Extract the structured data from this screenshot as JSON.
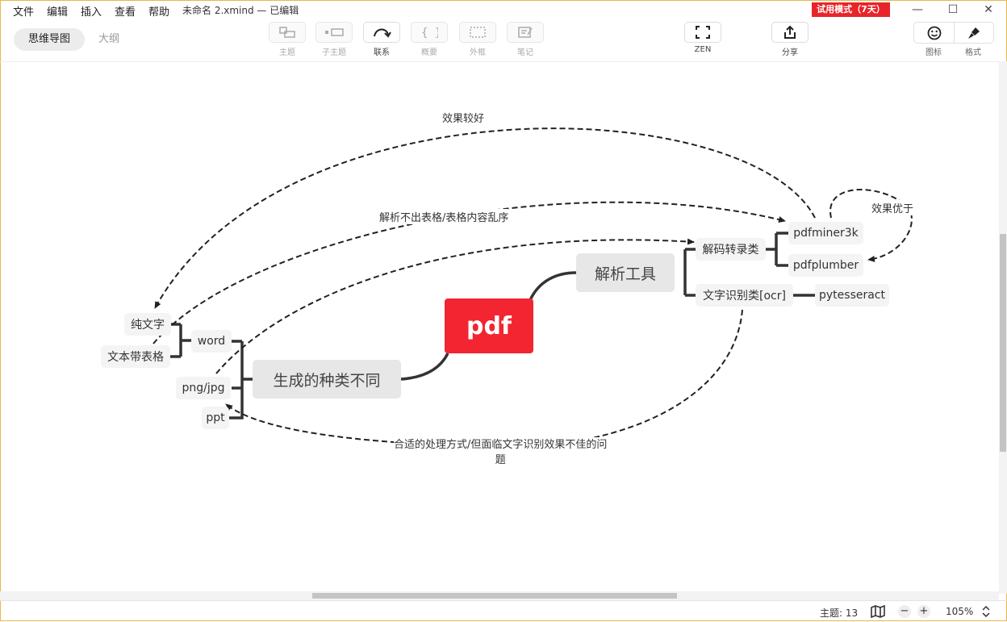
{
  "menu": [
    "文件",
    "编辑",
    "插入",
    "查看",
    "帮助"
  ],
  "window_title": "未命名 2.xmind — 已编辑",
  "trial_badge": "试用模式（7天）",
  "window_controls": {
    "minimize": "—",
    "maximize": "☐",
    "close": "✕"
  },
  "view_tabs": {
    "mindmap": "思维导图",
    "outline": "大纲"
  },
  "toolbar": {
    "topic": "主题",
    "subtopic": "子主题",
    "relationship": "联系",
    "summary": "概要",
    "boundary": "外框",
    "note": "笔记",
    "zen": "ZEN",
    "share": "分享",
    "icon": "图标",
    "format": "格式"
  },
  "map": {
    "root": "pdf",
    "main_left": "生成的种类不同",
    "main_right": "解析工具",
    "left_children": [
      "word",
      "png/jpg",
      "ppt"
    ],
    "word_children": [
      "纯文字",
      "文本带表格"
    ],
    "right_children": [
      "解码转录类",
      "文字识别类[ocr]"
    ],
    "decode_children": [
      "pdfminer3k",
      "pdfplumber"
    ],
    "ocr_children": [
      "pytesseract"
    ]
  },
  "relationships": {
    "r1": "效果较好",
    "r2": "解析不出表格/表格内容乱序",
    "r3": "效果优于",
    "r4_line1": "合适的处理方式/但面临文字识别效果不佳的问",
    "r4_line2": "题"
  },
  "status": {
    "topics": "主题: 13",
    "zoom": "105%"
  },
  "colors": {
    "root": "#f22530",
    "trial": "#e8242b",
    "branch": "#333333"
  }
}
